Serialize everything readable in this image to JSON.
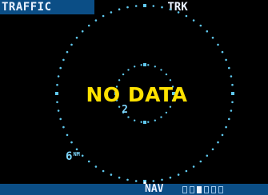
{
  "header": {
    "page_title": "TRAFFIC",
    "orientation": "TRK"
  },
  "display": {
    "status_message": "NO DATA",
    "inner_ring_range": "2",
    "outer_ring_range": "6",
    "outer_ring_unit": "NM",
    "ownship_icon": "ownship-icon"
  },
  "status_bar": {
    "mode": "NAV",
    "page_count": 6,
    "active_page": 3
  },
  "colors": {
    "background": "#000000",
    "title_bar": "#0b4e86",
    "ring": "#5fc8ee",
    "warning_text": "#ffe200",
    "label_text": "#7fd8ff"
  }
}
